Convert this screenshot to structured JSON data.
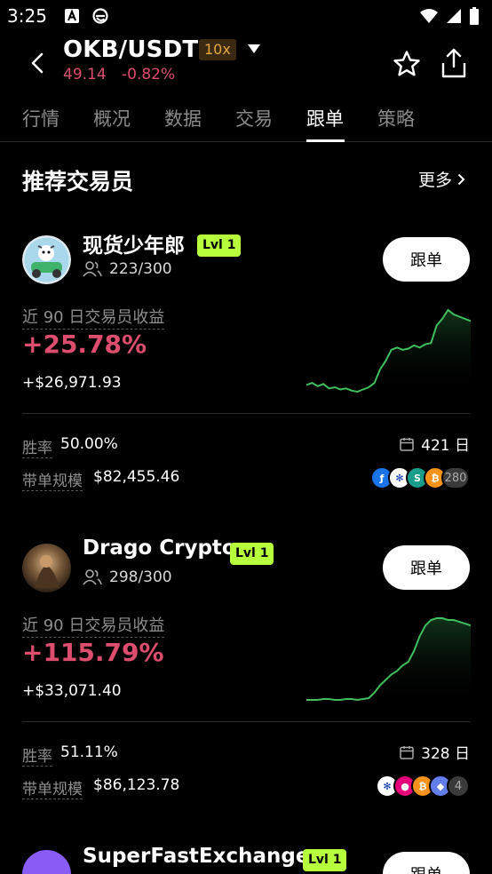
{
  "status_bar": {
    "time": "3:25"
  },
  "header": {
    "pair": "OKB/USDT",
    "leverage": "10x",
    "price": "49.14",
    "change": "-0.82%"
  },
  "tabs": [
    {
      "label": "行情"
    },
    {
      "label": "概况"
    },
    {
      "label": "数据"
    },
    {
      "label": "交易"
    },
    {
      "label": "跟单",
      "active": true
    },
    {
      "label": "策略"
    }
  ],
  "section": {
    "title": "推荐交易员",
    "more": "更多"
  },
  "traders": [
    {
      "name": "现货少年郎",
      "level": "Lvl 1",
      "followers": "223/300",
      "follow_label": "跟单",
      "pnl_label": "近 90 日交易员收益",
      "pnl_pct": "+25.78%",
      "pnl_usd": "+$26,971.93",
      "win_rate_label": "胜率",
      "win_rate": "50.00%",
      "days": "421 日",
      "size_label": "带单规模",
      "size": "$82,455.46",
      "coins": [
        "fetch",
        "cardano",
        "sei",
        "bitcoin"
      ],
      "coin_count": "280",
      "spark": [
        12,
        14,
        11,
        13,
        9,
        10,
        8,
        9,
        7,
        6,
        8,
        10,
        14,
        26,
        34,
        44,
        46,
        44,
        45,
        48,
        46,
        49,
        50,
        66,
        72,
        80,
        76,
        74,
        72,
        70
      ]
    },
    {
      "name": "Drago Crypto",
      "level": "Lvl 1",
      "followers": "298/300",
      "follow_label": "跟单",
      "pnl_label": "近 90 日交易员收益",
      "pnl_pct": "+115.79%",
      "pnl_usd": "+$33,071.40",
      "win_rate_label": "胜率",
      "win_rate": "51.11%",
      "days": "328 日",
      "size_label": "带单规模",
      "size": "$86,123.78",
      "coins": [
        "cardano",
        "polkadot",
        "bitcoin",
        "ethereum"
      ],
      "coin_count": "4",
      "spark": [
        2,
        2,
        2,
        3,
        3,
        2,
        2,
        3,
        3,
        2,
        3,
        4,
        10,
        18,
        24,
        30,
        34,
        40,
        44,
        56,
        72,
        84,
        90,
        92,
        92,
        90,
        90,
        88,
        86,
        84
      ]
    },
    {
      "name": "SuperFastExchanger",
      "level": "Lvl 1",
      "follow_label": "跟单"
    }
  ],
  "colors": {
    "negative": "#dc4d6e",
    "positive_line": "#3fbf5e",
    "level_badge": "#b7ff3c"
  }
}
